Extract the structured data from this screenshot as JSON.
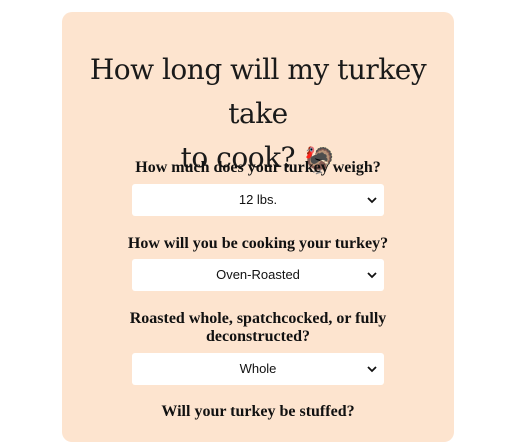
{
  "title": {
    "line1": "How long will my turkey take",
    "line2": "to cook?",
    "emoji": "🦃"
  },
  "questions": [
    {
      "label": "How much does your turkey weigh?",
      "selected": "12 lbs."
    },
    {
      "label": "How will you be cooking your turkey?",
      "selected": "Oven-Roasted"
    },
    {
      "label_line1": "Roasted whole, spatchcocked, or fully",
      "label_line2": "deconstructed?",
      "selected": "Whole"
    },
    {
      "label": "Will your turkey be stuffed?"
    }
  ],
  "colors": {
    "card_bg": "#fde4cf",
    "select_bg": "#ffffff"
  },
  "icons": {
    "turkey": "turkey-icon",
    "dropdown": "chevron-down-icon"
  }
}
